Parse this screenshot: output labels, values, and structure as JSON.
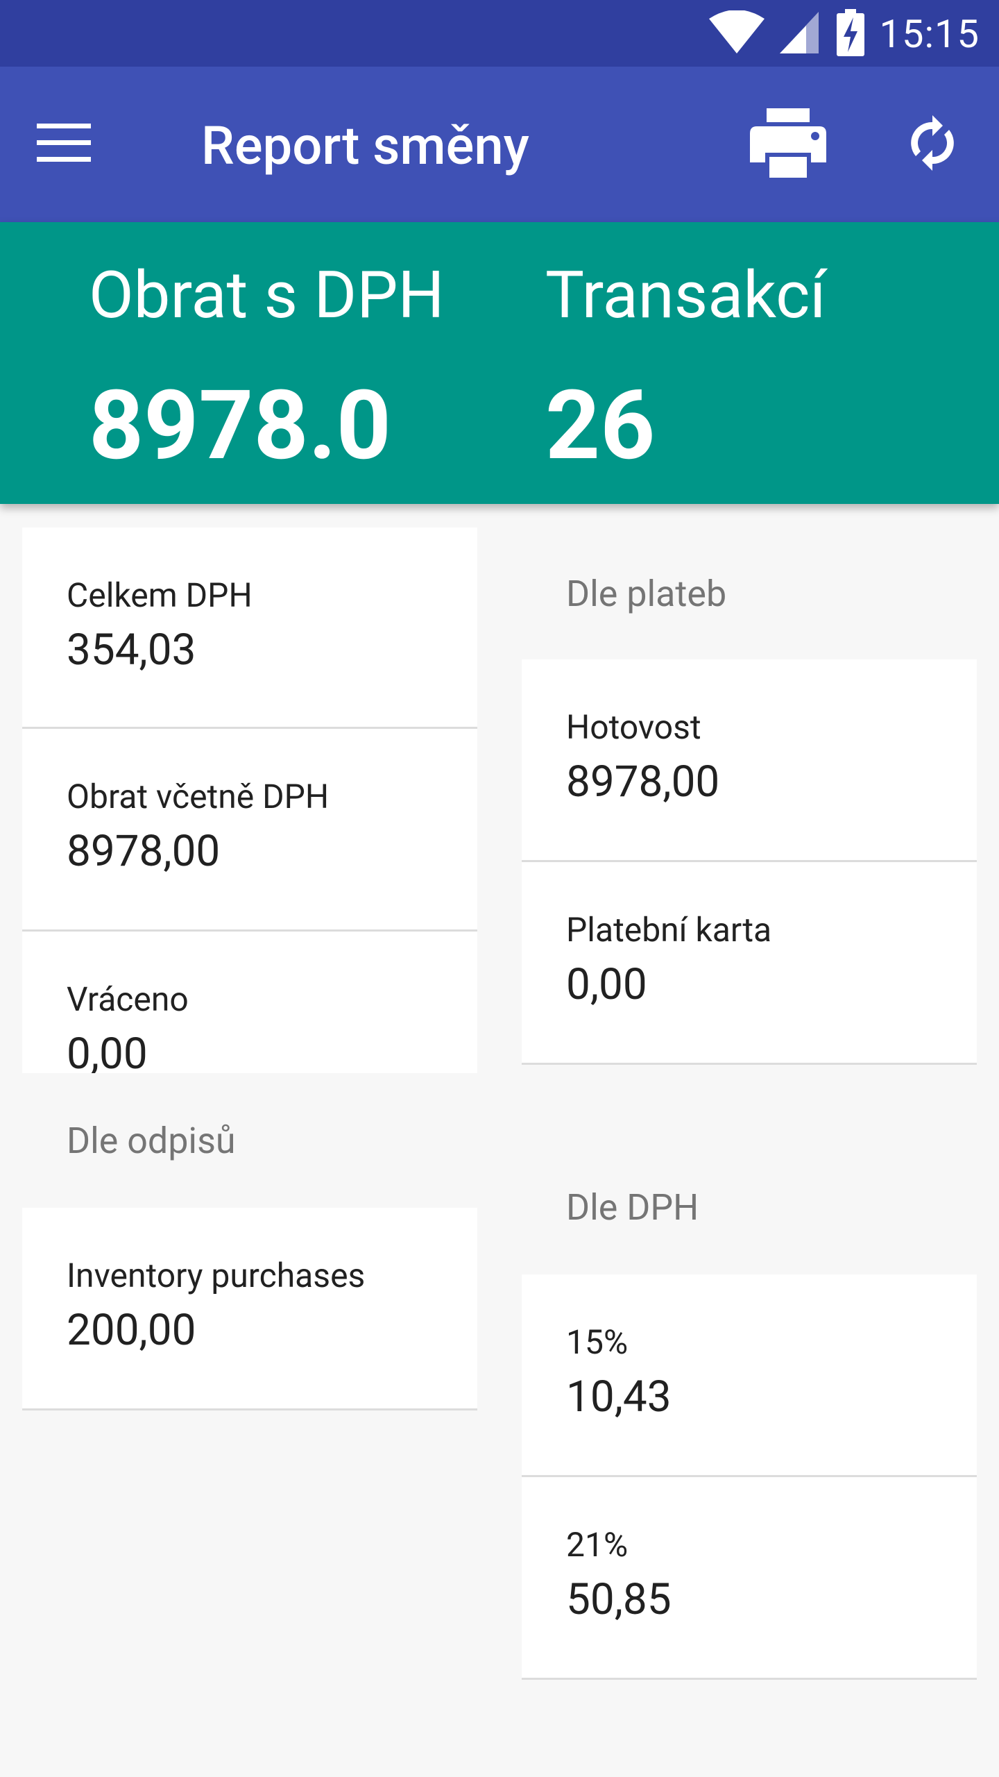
{
  "status_bar": {
    "time": "15:15",
    "icons": [
      "wifi-icon",
      "cell-signal-icon",
      "battery-charging-icon"
    ]
  },
  "app_bar": {
    "title": "Report směny",
    "icons": [
      "menu-icon",
      "print-icon",
      "sync-icon"
    ]
  },
  "summary": {
    "turnover_label": "Obrat s DPH",
    "turnover_value": "8978.0",
    "transactions_label": "Transakcí",
    "transactions_value": "26"
  },
  "left_column": {
    "cards": [
      {
        "label": "Celkem DPH",
        "value": "354,03"
      },
      {
        "label": "Obrat včetně DPH",
        "value": "8978,00"
      },
      {
        "label": "Vráceno",
        "value": "0,00"
      }
    ],
    "writeoffs_header": "Dle odpisů",
    "writeoffs": [
      {
        "label": "Inventory purchases",
        "value": "200,00"
      }
    ]
  },
  "right_column": {
    "payments_header": "Dle plateb",
    "payments": [
      {
        "label": "Hotovost",
        "value": "8978,00"
      },
      {
        "label": "Platební karta",
        "value": "0,00"
      }
    ],
    "vat_header": "Dle DPH",
    "vat": [
      {
        "label": "15%",
        "value": "10,43"
      },
      {
        "label": "21%",
        "value": "50,85"
      }
    ]
  },
  "colors": {
    "status_bar": "#303f9f",
    "app_bar": "#3f51b5",
    "summary": "#009688",
    "background": "#f7f7f7"
  }
}
